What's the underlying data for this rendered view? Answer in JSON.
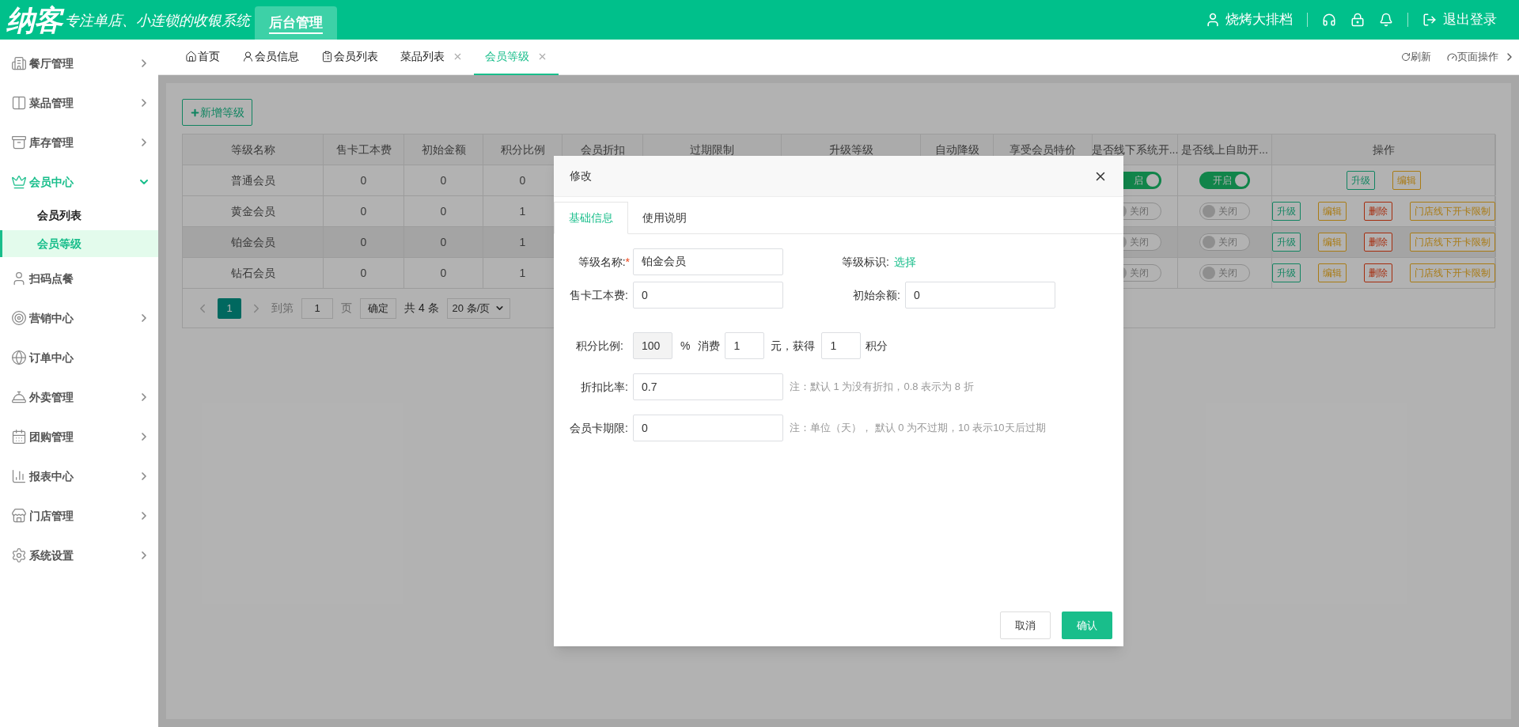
{
  "header": {
    "logo": "纳客",
    "slogan": "专注单店、小连锁的收银系统",
    "module_tab": {
      "label": "后台管理",
      "selected": true
    },
    "user": "烧烤大排档",
    "logout": "退出登录"
  },
  "sidebar": {
    "items": [
      {
        "label": "餐厅管理",
        "expanded": false,
        "has_children": true
      },
      {
        "label": "菜品管理",
        "expanded": false,
        "has_children": true
      },
      {
        "label": "库存管理",
        "expanded": false,
        "has_children": true
      },
      {
        "label": "会员中心",
        "expanded": true,
        "has_children": true,
        "children": [
          {
            "label": "会员列表",
            "selected": false
          },
          {
            "label": "会员等级",
            "selected": true
          }
        ]
      },
      {
        "label": "扫码点餐",
        "expanded": false,
        "has_children": false
      },
      {
        "label": "营销中心",
        "expanded": false,
        "has_children": true
      },
      {
        "label": "订单中心",
        "expanded": false,
        "has_children": false
      },
      {
        "label": "外卖管理",
        "expanded": false,
        "has_children": true
      },
      {
        "label": "团购管理",
        "expanded": false,
        "has_children": true
      },
      {
        "label": "报表中心",
        "expanded": false,
        "has_children": true
      },
      {
        "label": "门店管理",
        "expanded": false,
        "has_children": true
      },
      {
        "label": "系统设置",
        "expanded": false,
        "has_children": true
      }
    ]
  },
  "page_tabs": {
    "tabs": [
      {
        "label": "首页",
        "selected": false,
        "closable": false
      },
      {
        "label": "会员信息",
        "selected": false,
        "closable": false
      },
      {
        "label": "会员列表",
        "selected": false,
        "closable": false
      },
      {
        "label": "菜品列表",
        "selected": false,
        "closable": true
      },
      {
        "label": "会员等级",
        "selected": true,
        "closable": true
      }
    ],
    "refresh": "刷新",
    "page_ops": "页面操作"
  },
  "add_button": "新增等级",
  "table": {
    "columns": [
      "等级名称",
      "售卡工本费",
      "初始金额",
      "积分比例",
      "会员折扣",
      "过期限制",
      "升级等级",
      "自动降级",
      "享受会员特价",
      "是否线下系统开...",
      "是否线上自助开...",
      "操作"
    ],
    "rows": [
      {
        "cells": [
          "普通会员",
          "0",
          "0",
          "0"
        ],
        "selected": false,
        "offline": {
          "on": true,
          "label": "启"
        },
        "online": {
          "on": true,
          "label": "开启"
        },
        "actions": [
          {
            "kind": "upgrade",
            "label": "升级"
          },
          {
            "kind": "edit",
            "label": "编辑"
          }
        ]
      },
      {
        "cells": [
          "黄金会员",
          "0",
          "0",
          "1"
        ],
        "selected": false,
        "offline": {
          "on": false,
          "label": "关闭"
        },
        "online": {
          "on": false,
          "label": "关闭"
        },
        "actions": [
          {
            "kind": "upgrade",
            "label": "升级"
          },
          {
            "kind": "edit",
            "label": "编辑"
          },
          {
            "kind": "delete",
            "label": "删除"
          },
          {
            "kind": "limit",
            "label": "门店线下开卡限制"
          }
        ]
      },
      {
        "cells": [
          "铂金会员",
          "0",
          "0",
          "1"
        ],
        "selected": true,
        "offline": {
          "on": false,
          "label": "关闭"
        },
        "online": {
          "on": false,
          "label": "关闭"
        },
        "actions": [
          {
            "kind": "upgrade",
            "label": "升级"
          },
          {
            "kind": "edit",
            "label": "编辑"
          },
          {
            "kind": "delete",
            "label": "删除"
          },
          {
            "kind": "limit",
            "label": "门店线下开卡限制"
          }
        ]
      },
      {
        "cells": [
          "钻石会员",
          "0",
          "0",
          "1"
        ],
        "selected": false,
        "offline": {
          "on": false,
          "label": "关闭"
        },
        "online": {
          "on": false,
          "label": "关闭"
        },
        "actions": [
          {
            "kind": "upgrade",
            "label": "升级"
          },
          {
            "kind": "edit",
            "label": "编辑"
          },
          {
            "kind": "delete",
            "label": "删除"
          },
          {
            "kind": "limit",
            "label": "门店线下开卡限制"
          }
        ]
      }
    ]
  },
  "pagination": {
    "pages": [
      {
        "label": "1",
        "selected": true
      }
    ],
    "goto_label": "到第",
    "goto_value": "1",
    "page_unit": "页",
    "confirm": "确定",
    "total": "共 4 条",
    "page_size": "20 条/页"
  },
  "dialog": {
    "title": "修改",
    "tabs": [
      {
        "label": "基础信息",
        "selected": true
      },
      {
        "label": "使用说明",
        "selected": false
      }
    ],
    "name_field": {
      "label": "等级名称:",
      "required_mark": "*",
      "value": "铂金会员"
    },
    "badge_field": {
      "label": "等级标识:",
      "link": "选择"
    },
    "card_fee_field": {
      "label": "售卡工本费:",
      "value": "0"
    },
    "initial_balance_field": {
      "label": "初始余额:",
      "value": "0"
    },
    "points_ratio": {
      "label": "积分比例:",
      "percent": "100",
      "percent_disabled": true,
      "percent_sign": "%",
      "spend_label": "消费",
      "spend": "1",
      "yuan_label": "元，获得",
      "earn": "1",
      "points_label": "积分"
    },
    "discount_field": {
      "label": "折扣比率:",
      "value": "0.7",
      "note": "注：默认 1 为没有折扣，0.8 表示为 8 折"
    },
    "expiry_field": {
      "label": "会员卡期限:",
      "value": "0",
      "note": "注：单位（天）， 默认 0 为不过期，10 表示10天后过期"
    },
    "buttons": [
      {
        "kind": "cancel",
        "label": "取消"
      },
      {
        "kind": "confirm",
        "label": "确认"
      }
    ]
  }
}
